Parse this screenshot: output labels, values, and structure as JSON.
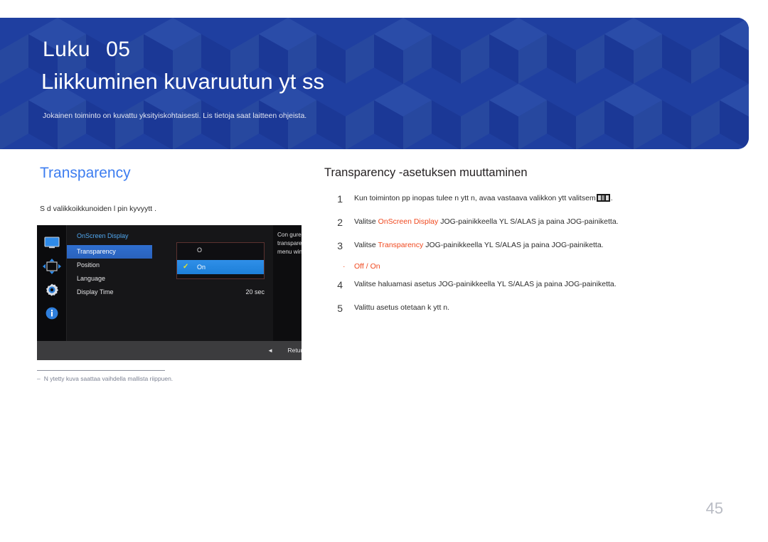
{
  "banner": {
    "chapter_label": "Luku",
    "chapter_number": "05",
    "title": "Liikkuminen kuvaruutun yt ss",
    "subtitle": "Jokainen toiminto on kuvattu yksityiskohtaisesti. Lis tietoja saat laitteen ohjeista.",
    "bg_color": "#1f3fa0"
  },
  "left": {
    "heading": "Transparency",
    "heading_color": "#3d7df0",
    "lead": "S d  valikkoikkunoiden l pin kyvyytt .",
    "footnote_dash": "‒",
    "footnote": "N ytetty kuva saattaa vaihdella mallista riippuen."
  },
  "osd": {
    "title": "OnScreen Display",
    "icons": [
      "monitor-icon",
      "position-arrows-icon",
      "gear-icon",
      "info-icon"
    ],
    "menu": [
      {
        "label": "Transparency",
        "value": "",
        "selected": true
      },
      {
        "label": "Position",
        "value": "",
        "selected": false
      },
      {
        "label": "Language",
        "value": "",
        "selected": false
      },
      {
        "label": "Display Time",
        "value": "20 sec",
        "selected": false
      }
    ],
    "submenu": [
      {
        "label": "O",
        "selected": false
      },
      {
        "label": "On",
        "selected": true
      }
    ],
    "check_glyph": "✓",
    "description": "Con gure the transparency of the menu windows.",
    "footer_arrow": "◄",
    "footer_return": "Return"
  },
  "right": {
    "heading": "Transparency -asetuksen muuttaminen",
    "steps": [
      {
        "num": "1",
        "pre": "Kun toiminton pp inopas tulee n ytt n, avaa vastaava valikkon ytt  valitsem",
        "icon": "jog-button-icon",
        "post": "."
      },
      {
        "num": "2",
        "pre": "Valitse ",
        "highlight": "OnScreen Display",
        "post": " JOG-painikkeella YL S/ALAS ja paina JOG-painiketta."
      },
      {
        "num": "3",
        "pre": "Valitse ",
        "highlight": "Transparency",
        "post": " JOG-painikkeella YL S/ALAS ja paina JOG-painiketta."
      },
      {
        "num": "4",
        "pre": "Valitse haluamasi asetus JOG-painikkeella YL S/ALAS ja paina JOG-painiketta.",
        "highlight": "",
        "post": ""
      },
      {
        "num": "5",
        "pre": "Valittu asetus otetaan k ytt n.",
        "highlight": "",
        "post": ""
      }
    ],
    "bullet": {
      "dot": "·",
      "text": "Off / On"
    },
    "accent_color": "#f0481e"
  },
  "page_number": "45"
}
